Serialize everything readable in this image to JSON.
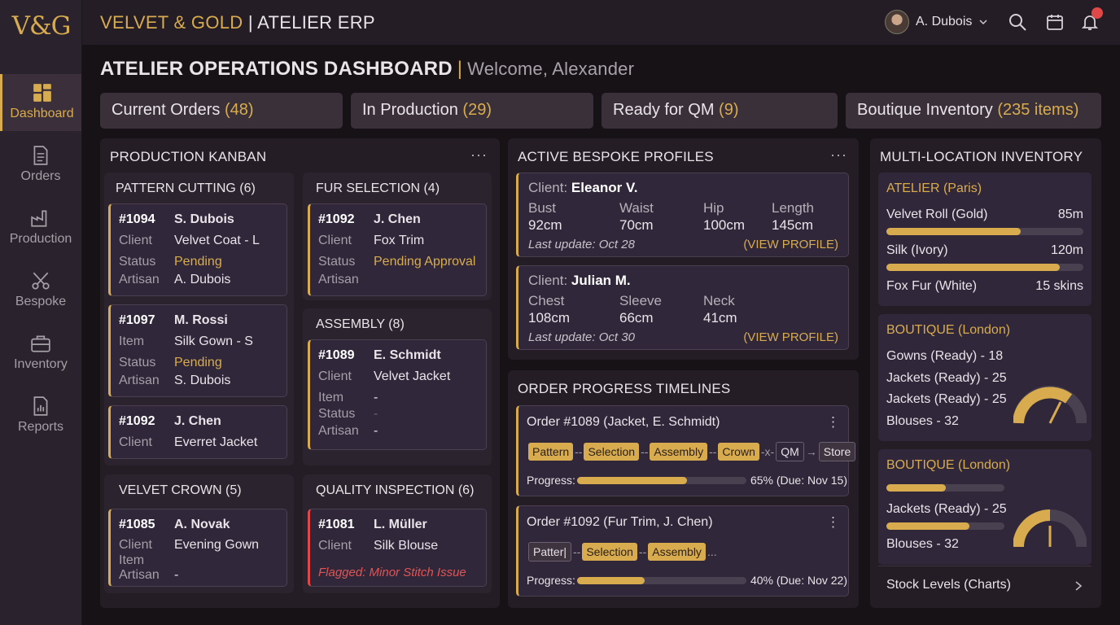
{
  "brand": {
    "logo": "V&G",
    "title": "VELVET & GOLD",
    "separator": " | ",
    "subtitle": "ATELIER ERP"
  },
  "user": {
    "name": "A. Dubois"
  },
  "sidebar": {
    "items": [
      {
        "label": "Dashboard",
        "icon": "grid-icon"
      },
      {
        "label": "Orders",
        "icon": "document-icon"
      },
      {
        "label": "Production",
        "icon": "factory-icon"
      },
      {
        "label": "Bespoke",
        "icon": "scissors-icon"
      },
      {
        "label": "Inventory",
        "icon": "briefcase-icon"
      },
      {
        "label": "Reports",
        "icon": "report-icon"
      }
    ]
  },
  "page": {
    "title": "ATELIER OPERATIONS DASHBOARD",
    "separator": "|",
    "welcome": "Welcome, Alexander"
  },
  "stats": [
    {
      "label": "Current Orders",
      "value": "(48)"
    },
    {
      "label": "In Production",
      "value": "(29)"
    },
    {
      "label": "Ready for QM",
      "value": "(9)"
    },
    {
      "label": "Boutique Inventory",
      "value": "(235 items)"
    }
  ],
  "kanban": {
    "title": "PRODUCTION KANBAN",
    "menu": "···",
    "columns": {
      "pattern": {
        "title": "PATTERN CUTTING (6)",
        "cards": [
          {
            "id": "#1094",
            "name": "S. Dubois",
            "k1": "Client",
            "v1": "Velvet Coat - L",
            "k2": "Status",
            "v2": "Pending",
            "k3": "Artisan",
            "v3": "A. Dubois"
          },
          {
            "id": "#1097",
            "name": "M. Rossi",
            "k1": "Item",
            "v1": "Silk Gown - S",
            "k2": "Status",
            "v2": "Pending",
            "k3": "Artisan",
            "v3": "S. Dubois"
          },
          {
            "id": "#1092",
            "name": "J. Chen",
            "k1": "Client",
            "v1": "Everret Jacket"
          }
        ]
      },
      "fur": {
        "title": "FUR SELECTION (4)",
        "cards": [
          {
            "id": "#1092",
            "name": "J. Chen",
            "k1": "Client",
            "v1": "Fox Trim",
            "k2": "Status",
            "v2": "Pending Approval",
            "k3": "Artisan",
            "v3": ""
          }
        ]
      },
      "assembly": {
        "title": "ASSEMBLY (8)",
        "cards": [
          {
            "id": "#1089",
            "name": "E. Schmidt",
            "k1": "Client",
            "v1": "Velvet Jacket",
            "k2": "Item",
            "v2": "-",
            "k3": "Status",
            "v3": "-",
            "k4": "Artisan",
            "v4": "-"
          }
        ]
      },
      "crown": {
        "title": "VELVET CROWN (5)",
        "cards": [
          {
            "id": "#1085",
            "name": "A. Novak",
            "k1": "Client",
            "v1": "Evening Gown",
            "k2": "Item",
            "v2": "",
            "k3": "Artisan",
            "v3": "-"
          }
        ]
      },
      "quality": {
        "title": "QUALITY INSPECTION (6)",
        "cards": [
          {
            "id": "#1081",
            "name": "L. Müller",
            "k1": "Client",
            "v1": "Silk Blouse",
            "flag": "Flagged: Minor Stitch Issue"
          }
        ]
      }
    }
  },
  "profiles": {
    "title": "ACTIVE BESPOKE PROFILES",
    "menu": "···",
    "items": [
      {
        "client_label": "Client:",
        "client": "Eleanor V.",
        "m": [
          {
            "k": "Bust",
            "v": "92cm"
          },
          {
            "k": "Waist",
            "v": "70cm"
          },
          {
            "k": "Hip",
            "v": "100cm"
          },
          {
            "k": "Length",
            "v": "145cm"
          }
        ],
        "update": "Last update: Oct 28",
        "link": "(VIEW PROFILE)"
      },
      {
        "client_label": "Client:",
        "client": "Julian M.",
        "m": [
          {
            "k": "Chest",
            "v": "108cm"
          },
          {
            "k": "Sleeve",
            "v": "66cm"
          },
          {
            "k": "Neck",
            "v": "41cm"
          }
        ],
        "update": "Last update: Oct 30",
        "link": "(VIEW PROFILE)"
      }
    ]
  },
  "timelines": {
    "title": "ORDER PROGRESS TIMELINES",
    "items": [
      {
        "order": "Order #1089 (Jacket, E. Schmidt)",
        "menu": "⋮",
        "steps": [
          "Pattern",
          "Selection",
          "Assembly",
          "Crown",
          "QM",
          "Store"
        ],
        "progress_label": "Progress:",
        "progress": 0.65,
        "progress_text": "65% (Due: Nov 15)"
      },
      {
        "order": "Order #1092 (Fur Trim, J. Chen)",
        "menu": "⋮",
        "steps": [
          "Patter|",
          "Selection",
          "Assembly"
        ],
        "ellipsis": "...",
        "progress_label": "Progress:",
        "progress": 0.4,
        "progress_text": "40% (Due: Nov 22)"
      }
    ]
  },
  "inventory": {
    "title": "MULTI-LOCATION INVENTORY",
    "atelier": {
      "title": "ATELIER (Paris)",
      "items": [
        {
          "name": "Velvet Roll (Gold)",
          "value": "85m",
          "level": 0.68
        },
        {
          "name": "Silk (Ivory)",
          "value": "120m",
          "level": 0.88
        },
        {
          "name": "Fox Fur (White)",
          "value": "15 skins"
        }
      ]
    },
    "boutique1": {
      "title": "BOUTIQUE (London)",
      "items": [
        "Gowns (Ready) - 18",
        "Jackets (Ready) - 25",
        "Jackets (Ready) - 25",
        "Blouses - 32"
      ]
    },
    "boutique2": {
      "title": "BOUTIQUE (London)",
      "items": [
        "Jackets (Ready) - 25",
        "Blouses - 32"
      ],
      "levels": [
        0.5,
        0.7
      ]
    },
    "footer": "Stock Levels (Charts)"
  },
  "colors": {
    "accent": "#d8ac4e",
    "flag": "#e04848",
    "bg": "#161216"
  }
}
